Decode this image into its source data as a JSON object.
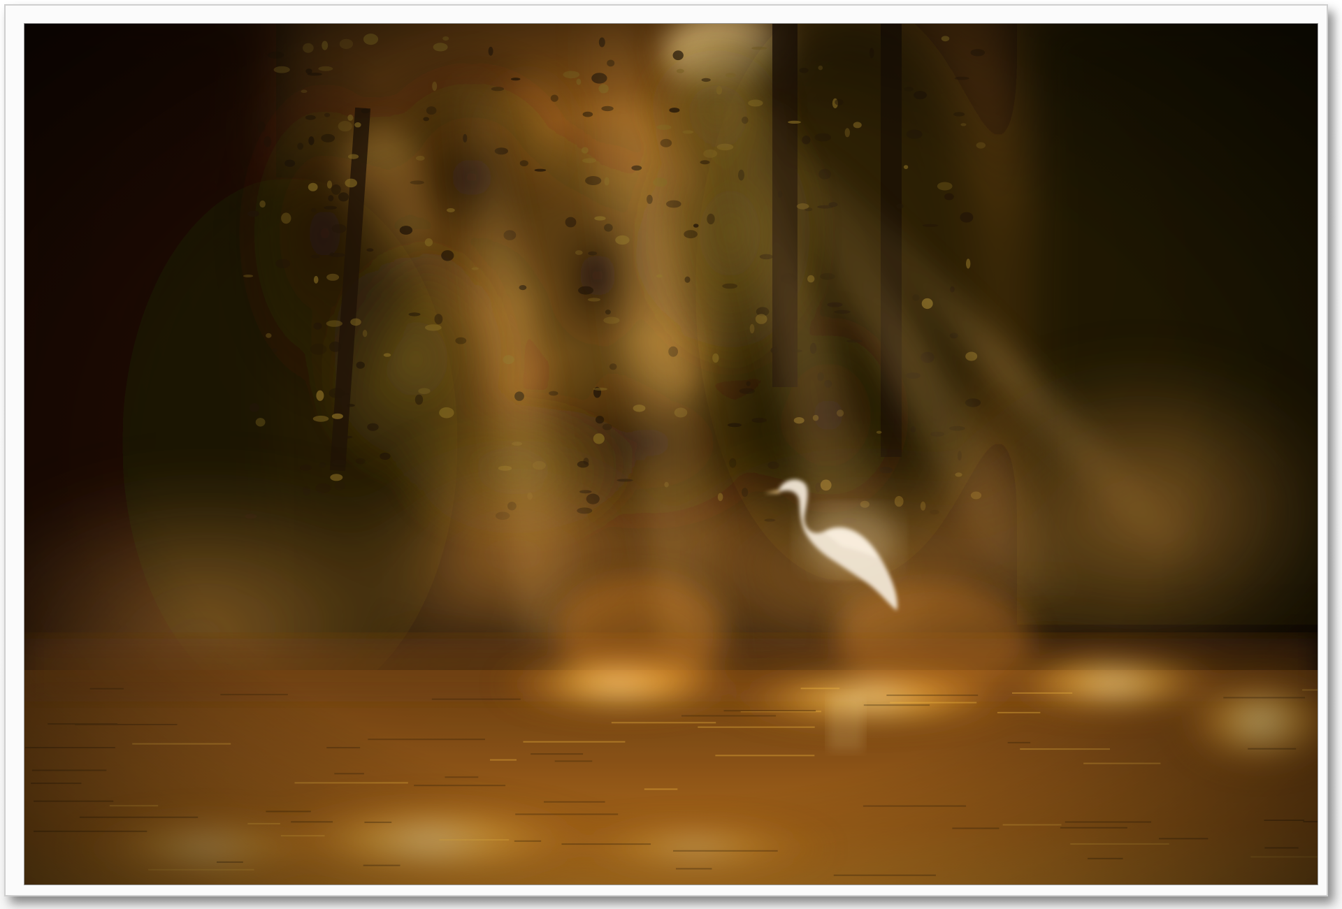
{
  "image": {
    "subject": "egret-in-misty-forest",
    "palette": {
      "shadow": "#0c0804",
      "deep": "#2a1a08",
      "amber": "#d98a1e",
      "gold": "#ffc84a",
      "glow": "#fff1b8",
      "egret": "#f4efe6"
    }
  }
}
